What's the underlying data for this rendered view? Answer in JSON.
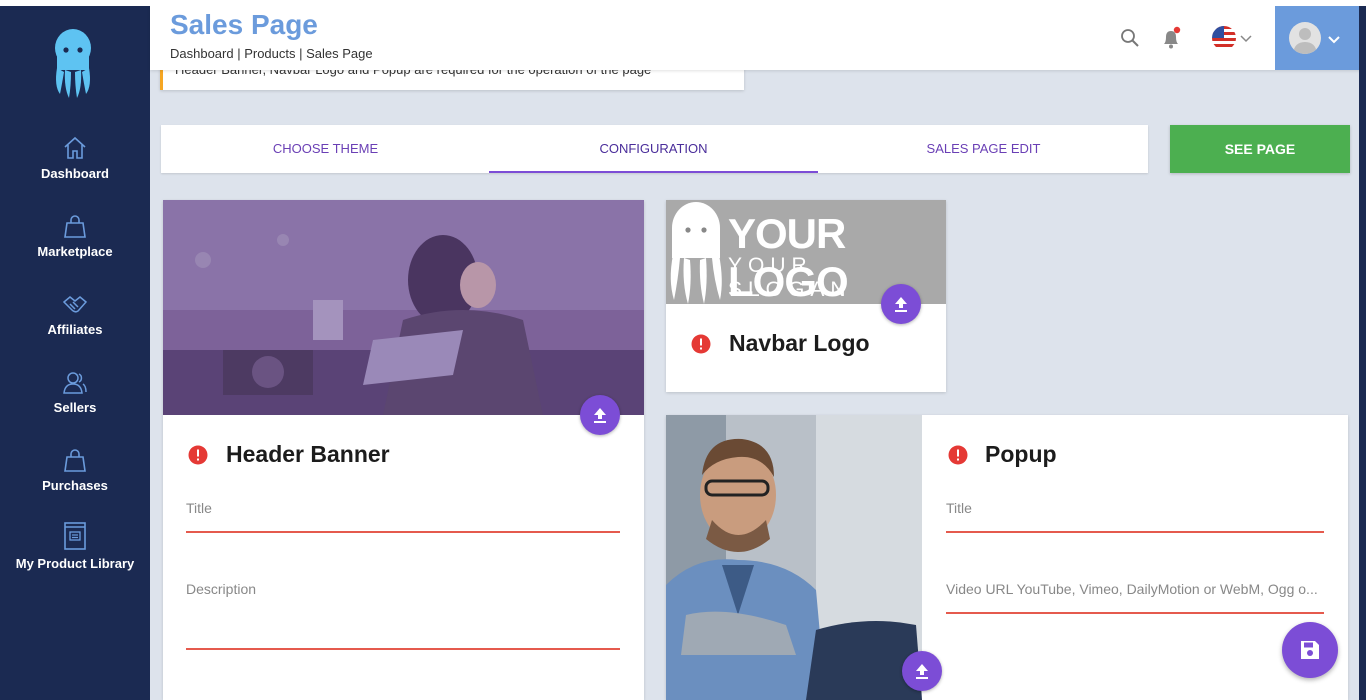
{
  "header": {
    "title": "Sales Page",
    "breadcrumb": "Dashboard | Products | Sales Page"
  },
  "notice": "Header Banner, Navbar Logo and Popup are required for the operation of the page",
  "sidebar": {
    "items": [
      {
        "label": "Dashboard",
        "icon": "home-icon"
      },
      {
        "label": "Marketplace",
        "icon": "shopping-bag-icon"
      },
      {
        "label": "Affiliates",
        "icon": "handshake-icon"
      },
      {
        "label": "Sellers",
        "icon": "users-icon"
      },
      {
        "label": "Purchases",
        "icon": "shopping-bag-icon"
      },
      {
        "label": "My Product Library",
        "icon": "book-icon"
      }
    ]
  },
  "tabs": [
    {
      "label": "CHOOSE THEME"
    },
    {
      "label": "CONFIGURATION",
      "active": true
    },
    {
      "label": "SALES PAGE EDIT"
    }
  ],
  "see_page_label": "SEE PAGE",
  "header_banner": {
    "title": "Header Banner",
    "title_placeholder": "Title",
    "description_placeholder": "Description"
  },
  "navbar_logo": {
    "title": "Navbar Logo",
    "logo_main": "YOUR LOGO",
    "logo_slogan": "YOUR SLOGAN"
  },
  "popup": {
    "title": "Popup",
    "title_placeholder": "Title",
    "video_placeholder": "Video URL YouTube, Vimeo, DailyMotion or WebM, Ogg o..."
  },
  "colors": {
    "sidebar": "#1b2a52",
    "accent": "#7c4dd6",
    "brand_blue": "#6b9bdc",
    "success": "#4caf50",
    "error": "#e53935",
    "warning": "#f5a623"
  }
}
